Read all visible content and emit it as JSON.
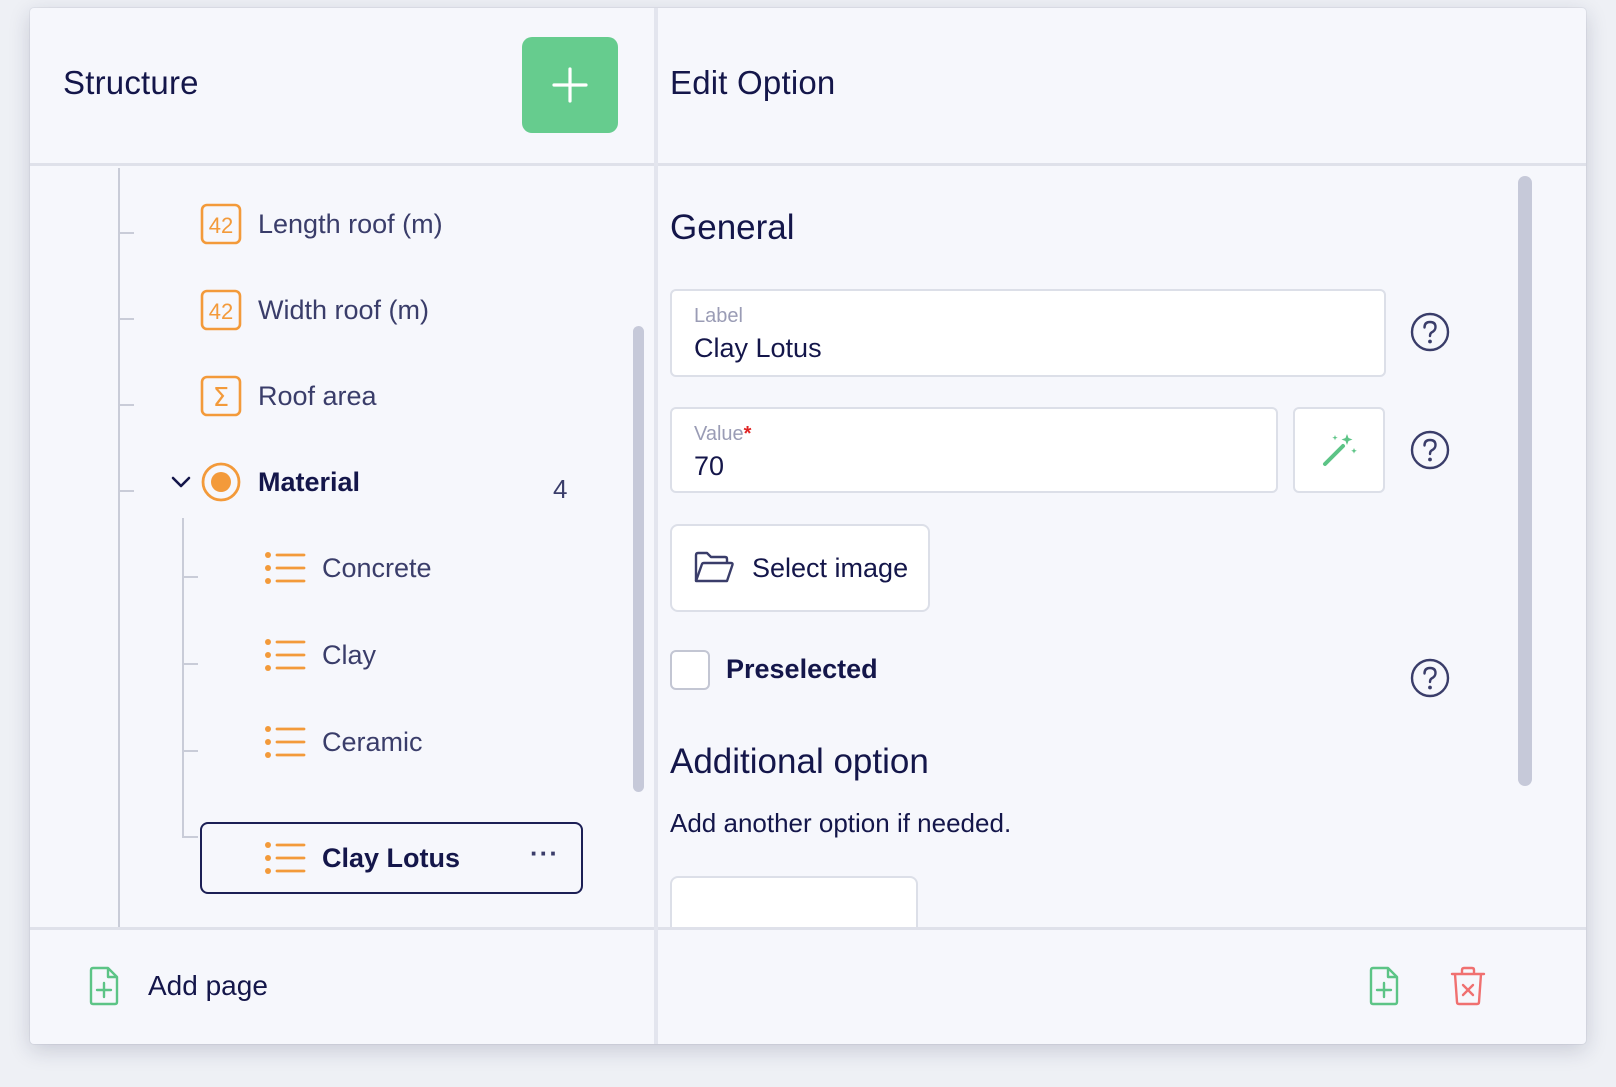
{
  "structure": {
    "title": "Structure",
    "add_button_icon": "plus-icon",
    "tree": [
      {
        "label": "Length roof (m)",
        "icon": "number-42-icon"
      },
      {
        "label": "Width roof (m)",
        "icon": "number-42-icon"
      },
      {
        "label": "Roof area",
        "icon": "sigma-icon"
      },
      {
        "label": "Material",
        "icon": "radio-icon",
        "count": "4",
        "expanded": true
      },
      {
        "label": "Concrete",
        "icon": "list-icon"
      },
      {
        "label": "Clay",
        "icon": "list-icon"
      },
      {
        "label": "Ceramic",
        "icon": "list-icon"
      },
      {
        "label": "Clay Lotus",
        "icon": "list-icon",
        "selected": true
      }
    ],
    "number_badge": "42",
    "sigma_glyph": "Σ",
    "more_glyph": "···",
    "footer": {
      "add_page_label": "Add page"
    }
  },
  "edit": {
    "title": "Edit Option",
    "general_title": "General",
    "label_field": {
      "label": "Label",
      "value": "Clay Lotus"
    },
    "value_field": {
      "label": "Value",
      "required_mark": "*",
      "value": "70"
    },
    "select_image_label": "Select image",
    "preselected_label": "Preselected",
    "additional_title": "Additional option",
    "additional_desc": "Add another option if needed."
  },
  "colors": {
    "accent_green": "#66cc8e",
    "icon_orange": "#f39a3a",
    "delete_red": "#f07070",
    "text_dark": "#14164a"
  }
}
